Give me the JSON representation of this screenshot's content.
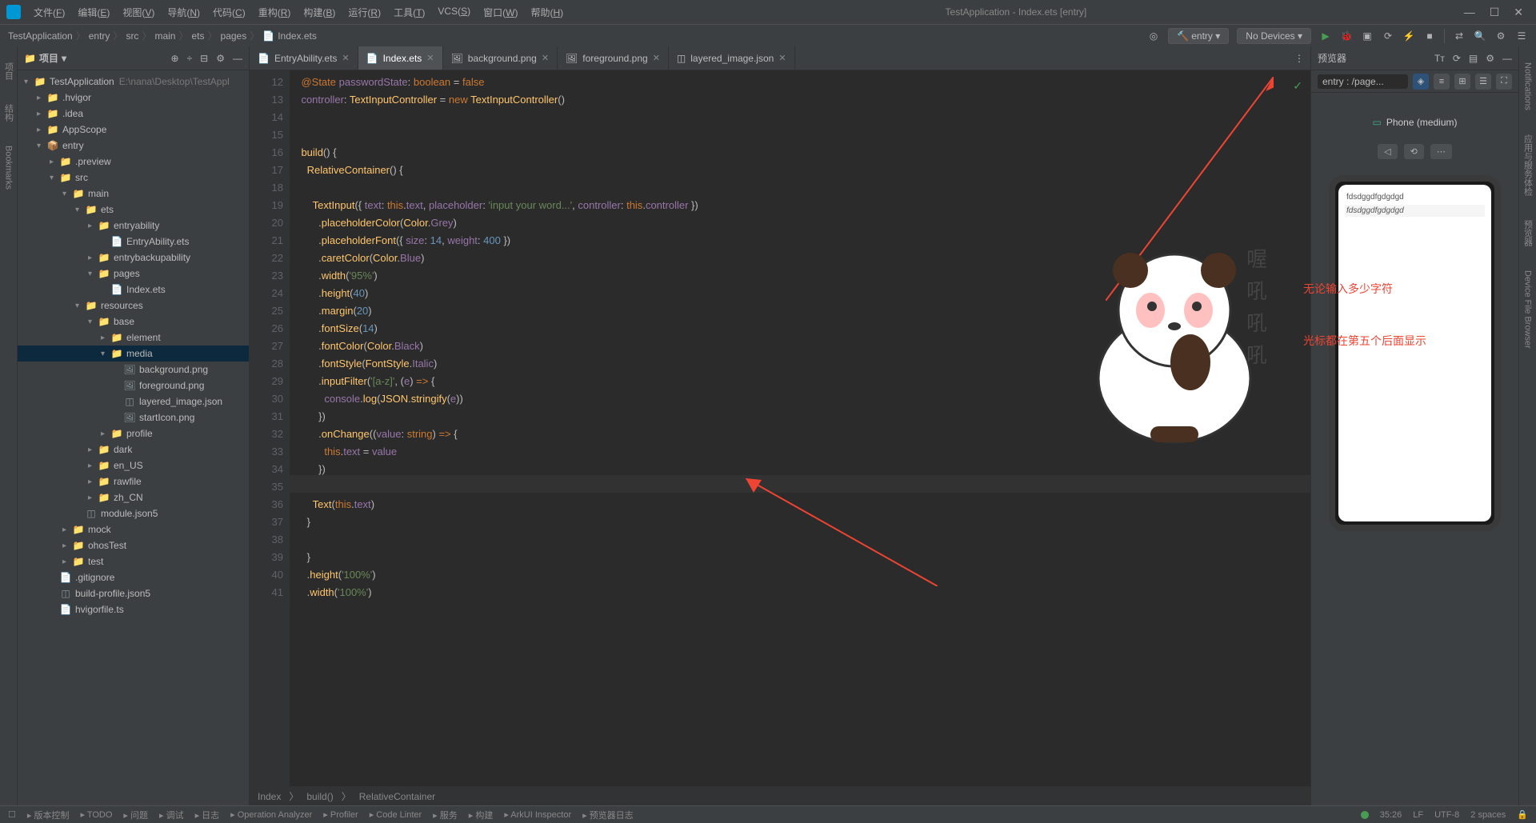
{
  "window": {
    "title": "TestApplication - Index.ets [entry]"
  },
  "menus": [
    {
      "label": "文件",
      "key": "F"
    },
    {
      "label": "编辑",
      "key": "E"
    },
    {
      "label": "视图",
      "key": "V"
    },
    {
      "label": "导航",
      "key": "N"
    },
    {
      "label": "代码",
      "key": "C"
    },
    {
      "label": "重构",
      "key": "R"
    },
    {
      "label": "构建",
      "key": "B"
    },
    {
      "label": "运行",
      "key": "R"
    },
    {
      "label": "工具",
      "key": "T"
    },
    {
      "label": "VCS",
      "key": "S"
    },
    {
      "label": "窗口",
      "key": "W"
    },
    {
      "label": "帮助",
      "key": "H"
    }
  ],
  "breadcrumb": [
    "TestApplication",
    "entry",
    "src",
    "main",
    "ets",
    "pages",
    "Index.ets"
  ],
  "runConfig": {
    "module": "entry",
    "device": "No Devices"
  },
  "sidebar": {
    "title": "项目",
    "tree": [
      {
        "indent": 0,
        "arrow": "▾",
        "icon": "folder-root",
        "label": "TestApplication",
        "path": "E:\\nana\\Desktop\\TestAppl"
      },
      {
        "indent": 1,
        "arrow": "▸",
        "icon": "folder-orange",
        "label": ".hvigor"
      },
      {
        "indent": 1,
        "arrow": "▸",
        "icon": "folder-orange",
        "label": ".idea"
      },
      {
        "indent": 1,
        "arrow": "▸",
        "icon": "folder",
        "label": "AppScope"
      },
      {
        "indent": 1,
        "arrow": "▾",
        "icon": "folder-module",
        "label": "entry",
        "selected": false
      },
      {
        "indent": 2,
        "arrow": "▸",
        "icon": "folder-orange",
        "label": ".preview"
      },
      {
        "indent": 2,
        "arrow": "▾",
        "icon": "folder",
        "label": "src"
      },
      {
        "indent": 3,
        "arrow": "▾",
        "icon": "folder",
        "label": "main"
      },
      {
        "indent": 4,
        "arrow": "▾",
        "icon": "folder",
        "label": "ets"
      },
      {
        "indent": 5,
        "arrow": "▸",
        "icon": "folder",
        "label": "entryability"
      },
      {
        "indent": 6,
        "arrow": "",
        "icon": "ets",
        "label": "EntryAbility.ets"
      },
      {
        "indent": 5,
        "arrow": "▸",
        "icon": "folder",
        "label": "entrybackupability"
      },
      {
        "indent": 5,
        "arrow": "▾",
        "icon": "folder",
        "label": "pages"
      },
      {
        "indent": 6,
        "arrow": "",
        "icon": "ets",
        "label": "Index.ets"
      },
      {
        "indent": 4,
        "arrow": "▾",
        "icon": "folder",
        "label": "resources"
      },
      {
        "indent": 5,
        "arrow": "▾",
        "icon": "folder",
        "label": "base"
      },
      {
        "indent": 6,
        "arrow": "▸",
        "icon": "folder",
        "label": "element"
      },
      {
        "indent": 6,
        "arrow": "▾",
        "icon": "folder",
        "label": "media",
        "selected": true
      },
      {
        "indent": 7,
        "arrow": "",
        "icon": "img",
        "label": "background.png"
      },
      {
        "indent": 7,
        "arrow": "",
        "icon": "img",
        "label": "foreground.png"
      },
      {
        "indent": 7,
        "arrow": "",
        "icon": "json",
        "label": "layered_image.json"
      },
      {
        "indent": 7,
        "arrow": "",
        "icon": "img",
        "label": "startIcon.png"
      },
      {
        "indent": 6,
        "arrow": "▸",
        "icon": "folder",
        "label": "profile"
      },
      {
        "indent": 5,
        "arrow": "▸",
        "icon": "folder",
        "label": "dark"
      },
      {
        "indent": 5,
        "arrow": "▸",
        "icon": "folder",
        "label": "en_US"
      },
      {
        "indent": 5,
        "arrow": "▸",
        "icon": "folder",
        "label": "rawfile"
      },
      {
        "indent": 5,
        "arrow": "▸",
        "icon": "folder",
        "label": "zh_CN"
      },
      {
        "indent": 4,
        "arrow": "",
        "icon": "json",
        "label": "module.json5"
      },
      {
        "indent": 3,
        "arrow": "▸",
        "icon": "folder",
        "label": "mock"
      },
      {
        "indent": 3,
        "arrow": "▸",
        "icon": "folder",
        "label": "ohosTest"
      },
      {
        "indent": 3,
        "arrow": "▸",
        "icon": "folder",
        "label": "test"
      },
      {
        "indent": 2,
        "arrow": "",
        "icon": "file",
        "label": ".gitignore"
      },
      {
        "indent": 2,
        "arrow": "",
        "icon": "json",
        "label": "build-profile.json5"
      },
      {
        "indent": 2,
        "arrow": "",
        "icon": "ts",
        "label": "hvigorfile.ts"
      }
    ]
  },
  "tabs": [
    {
      "label": "EntryAbility.ets",
      "icon": "ets"
    },
    {
      "label": "Index.ets",
      "icon": "ets",
      "active": true
    },
    {
      "label": "background.png",
      "icon": "img"
    },
    {
      "label": "foreground.png",
      "icon": "img"
    },
    {
      "label": "layered_image.json",
      "icon": "json"
    }
  ],
  "gutter": {
    "start": 12,
    "end": 41
  },
  "code_breadcrumb": [
    "Index",
    "build()",
    "RelativeContainer"
  ],
  "preview": {
    "title": "预览器",
    "path": "entry : /page...",
    "device": "Phone (medium)",
    "input1": "fdsdggdfgdgdgd",
    "input2": "fdsdggdfgdgdgd",
    "note1": "无论输入多少字符",
    "note2": "光标都在第五个后面显示"
  },
  "left_gutter": [
    "项目",
    "结构",
    "Bookmarks"
  ],
  "right_gutter": [
    "Notifications",
    "应用与服务体检",
    "预览器",
    "Device File Browser"
  ],
  "statusbar": {
    "items": [
      "版本控制",
      "TODO",
      "问题",
      "调试",
      "日志",
      "Operation Analyzer",
      "Profiler",
      "Code Linter",
      "服务",
      "构建",
      "ArkUI Inspector",
      "预览器日志"
    ],
    "right": [
      "35:26",
      "LF",
      "UTF-8",
      "2 spaces"
    ]
  },
  "panda_text": [
    "喔",
    "吼",
    "吼",
    "吼"
  ]
}
